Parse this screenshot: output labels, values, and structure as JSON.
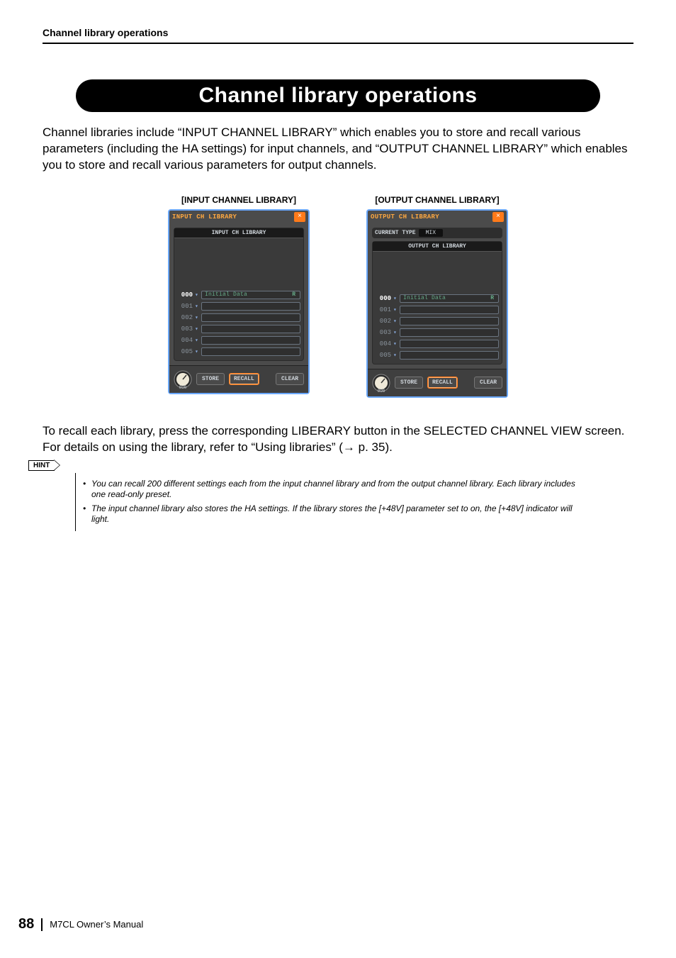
{
  "runningHead": "Channel library operations",
  "title": "Channel library operations",
  "intro": "Channel libraries include “INPUT CHANNEL LIBRARY” which enables you to store and recall various parameters (including the HA settings) for input channels, and “OUTPUT CHANNEL LIBRARY” which enables you to store and recall various parameters for output channels.",
  "para2_a": "To recall each library, press the corresponding LIBERARY button in the SELECTED CHANNEL VIEW screen. For details on using the library, refer to “Using libraries” (",
  "para2_ref": "→ p. 35",
  "para2_b": ").",
  "hintLabel": "HINT",
  "hints": [
    "You can recall 200 different settings each from the input channel library and from the output channel library. Each library includes one read-only preset.",
    "The input channel library also stores the HA settings. If the library stores the [+48V] parameter set to on, the [+48V] indicator will light."
  ],
  "screens": {
    "input": {
      "caption": "[INPUT CHANNEL LIBRARY]",
      "popupTitle": "INPUT CH LIBRARY",
      "listHeader": "INPUT CH LIBRARY",
      "rows": [
        {
          "num": "000",
          "name": "Initial Data",
          "flag": "R",
          "sel": true
        },
        {
          "num": "001",
          "name": "",
          "flag": "",
          "sel": false
        },
        {
          "num": "002",
          "name": "",
          "flag": "",
          "sel": false
        },
        {
          "num": "003",
          "name": "",
          "flag": "",
          "sel": false
        },
        {
          "num": "004",
          "name": "",
          "flag": "",
          "sel": false
        },
        {
          "num": "005",
          "name": "",
          "flag": "",
          "sel": false
        }
      ],
      "knobLabel": "000",
      "buttons": {
        "store": "STORE",
        "recall": "RECALL",
        "clear": "CLEAR"
      }
    },
    "output": {
      "caption": "[OUTPUT CHANNEL LIBRARY]",
      "popupTitle": "OUTPUT CH LIBRARY",
      "currentTypeLabel": "CURRENT TYPE",
      "currentTypeValue": "MIX",
      "listHeader": "OUTPUT CH LIBRARY",
      "rows": [
        {
          "num": "000",
          "name": "Initial Data",
          "flag": "R",
          "sel": true
        },
        {
          "num": "001",
          "name": "",
          "flag": "",
          "sel": false
        },
        {
          "num": "002",
          "name": "",
          "flag": "",
          "sel": false
        },
        {
          "num": "003",
          "name": "",
          "flag": "",
          "sel": false
        },
        {
          "num": "004",
          "name": "",
          "flag": "",
          "sel": false
        },
        {
          "num": "005",
          "name": "",
          "flag": "",
          "sel": false
        }
      ],
      "knobLabel": "000",
      "buttons": {
        "store": "STORE",
        "recall": "RECALL",
        "clear": "CLEAR"
      }
    }
  },
  "footer": {
    "page": "88",
    "text": "M7CL  Owner’s Manual"
  }
}
